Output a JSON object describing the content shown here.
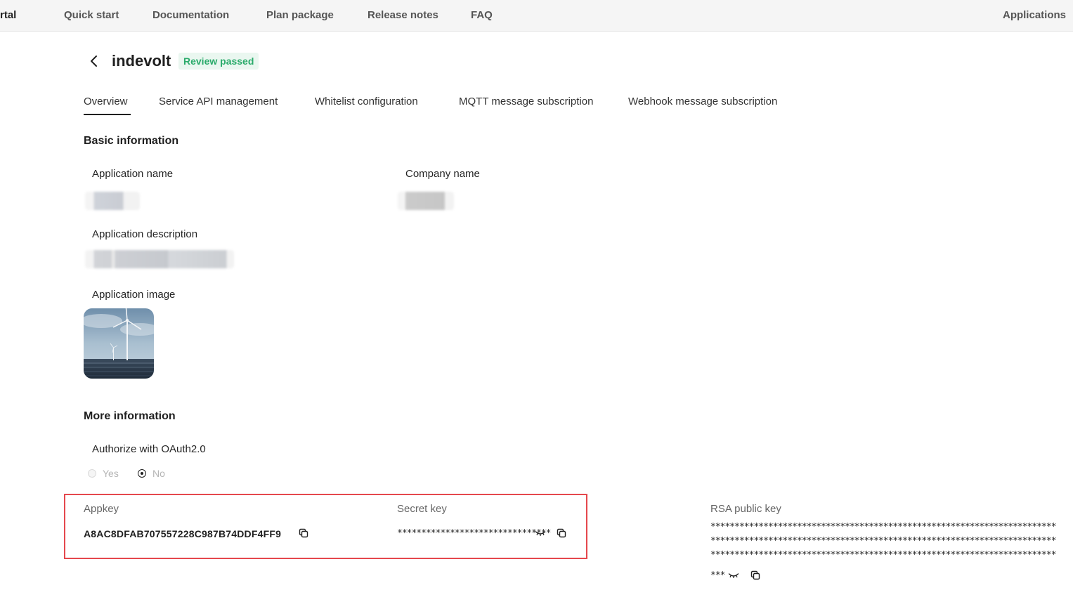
{
  "topbar": {
    "brand": "rtal",
    "nav": [
      "Quick start",
      "Documentation",
      "Plan package",
      "Release notes",
      "FAQ"
    ],
    "right_link": "Applications"
  },
  "header": {
    "title": "indevolt",
    "status": "Review passed"
  },
  "tabs": [
    "Overview",
    "Service API management",
    "Whitelist configuration",
    "MQTT message subscription",
    "Webhook message subscription"
  ],
  "active_tab": "Overview",
  "basic": {
    "section_title": "Basic information",
    "app_name_label": "Application name",
    "company_name_label": "Company name",
    "app_desc_label": "Application description",
    "app_image_label": "Application image"
  },
  "more": {
    "section_title": "More information",
    "oauth_label": "Authorize with OAuth2.0",
    "oauth_options": [
      "Yes",
      "No"
    ],
    "oauth_selected": "No"
  },
  "keys": {
    "appkey_label": "Appkey",
    "appkey_value": "A8AC8DFAB707557228C987B74DDF4FF9",
    "secret_label": "Secret key",
    "secret_mask": "********************************",
    "rsa_label": "RSA public key",
    "rsa_mask_lines": [
      "************************************************************************",
      "************************************************************************",
      "************************************************************************",
      "***"
    ]
  },
  "icons": {
    "back": "chevron-left-icon",
    "copy": "copy-icon",
    "hidden": "eye-closed-icon"
  },
  "colors": {
    "accent_dark": "#1f1f1f",
    "success": "#2bab6b",
    "highlight": "#e5484d",
    "topbar_bg": "#f5f5f5"
  }
}
